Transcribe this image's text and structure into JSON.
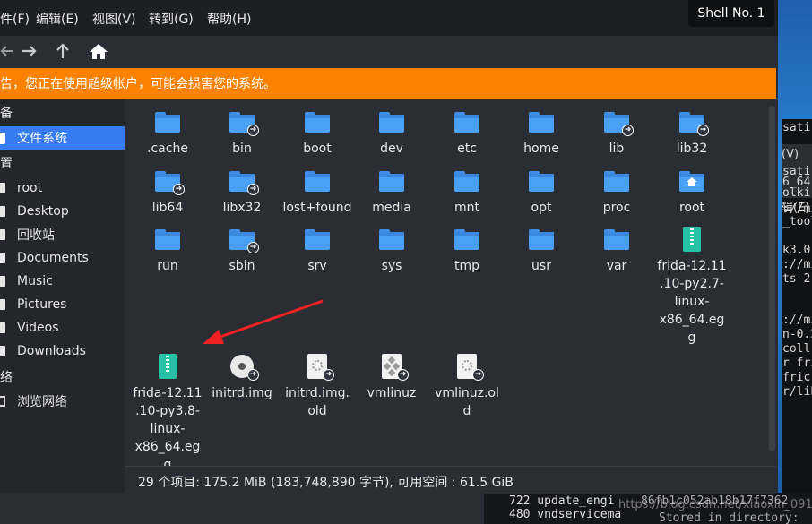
{
  "window": {
    "menus": [
      "件(F)",
      "编辑(E)",
      "视图(V)",
      "转到(G)",
      "帮助(H)"
    ],
    "tooltip": "Shell No. 1",
    "path": "/",
    "warning": "告，您正在使用超级帐户，可能会损害您的系统。"
  },
  "sidebar": {
    "heading_devices": "备",
    "filesystem": "文件系统",
    "heading_places": "置",
    "items": [
      "root",
      "Desktop",
      "回收站",
      "Documents",
      "Music",
      "Pictures",
      "Videos",
      "Downloads"
    ],
    "heading_network": "络",
    "browse_network": "浏览网络"
  },
  "files": [
    {
      "name": ".cache",
      "icon": "folder-icon",
      "link": false
    },
    {
      "name": "bin",
      "icon": "folder-icon",
      "link": true
    },
    {
      "name": "boot",
      "icon": "folder-icon",
      "link": false
    },
    {
      "name": "dev",
      "icon": "folder-icon",
      "link": false
    },
    {
      "name": "etc",
      "icon": "folder-icon",
      "link": false
    },
    {
      "name": "home",
      "icon": "folder-icon",
      "link": false
    },
    {
      "name": "lib",
      "icon": "folder-icon",
      "link": true
    },
    {
      "name": "lib32",
      "icon": "folder-icon",
      "link": true
    },
    {
      "name": "lib64",
      "icon": "folder-icon",
      "link": true
    },
    {
      "name": "libx32",
      "icon": "folder-icon",
      "link": true
    },
    {
      "name": "lost+found",
      "icon": "folder-icon",
      "link": false
    },
    {
      "name": "media",
      "icon": "folder-icon",
      "link": false
    },
    {
      "name": "mnt",
      "icon": "folder-icon",
      "link": false
    },
    {
      "name": "opt",
      "icon": "folder-icon",
      "link": false
    },
    {
      "name": "proc",
      "icon": "folder-icon",
      "link": false
    },
    {
      "name": "root",
      "icon": "home-folder-icon",
      "link": false
    },
    {
      "name": "run",
      "icon": "folder-icon",
      "link": false
    },
    {
      "name": "sbin",
      "icon": "folder-icon",
      "link": true
    },
    {
      "name": "srv",
      "icon": "folder-icon",
      "link": false
    },
    {
      "name": "sys",
      "icon": "folder-icon",
      "link": false
    },
    {
      "name": "tmp",
      "icon": "folder-icon",
      "link": false
    },
    {
      "name": "usr",
      "icon": "folder-icon",
      "link": false
    },
    {
      "name": "var",
      "icon": "folder-icon",
      "link": false
    },
    {
      "name": "frida-12.11.10-py2.7-linux-x86_64.egg",
      "icon": "archive-icon",
      "link": false
    },
    {
      "name": "frida-12.11.10-py3.8-linux-x86_64.egg",
      "icon": "archive-icon",
      "link": false
    },
    {
      "name": "initrd.img",
      "icon": "disc-image-icon",
      "link": true
    },
    {
      "name": "initrd.img.old",
      "icon": "document-icon",
      "link": true
    },
    {
      "name": "vmlinuz",
      "icon": "executable-icon",
      "link": true
    },
    {
      "name": "vmlinuz.old",
      "icon": "document-icon",
      "link": true
    }
  ],
  "status": "29 个项目: 175.2 MiB (183,748,890 字节), 可用空间 : 61.5 GiB",
  "background": {
    "terminal_menu": [
      "(V)",
      "辑(E)"
    ],
    "terminal_lines": [
      "sati",
      "sati",
      "6_64.",
      "olki",
      "://mi",
      "_tool",
      "k3.0.",
      "://mi",
      "ts-2.",
      "://mi",
      "n-0.2",
      " coll",
      "r fri",
      " fric",
      "r/lib"
    ],
    "bottom_lines": [
      "722   update_engi",
      "480   vndservicema",
      "86fb1c052ab18b17f7362",
      "Stored in directory:"
    ],
    "watermark": "https://blog.csdn.net/xiaoxin_0917"
  }
}
